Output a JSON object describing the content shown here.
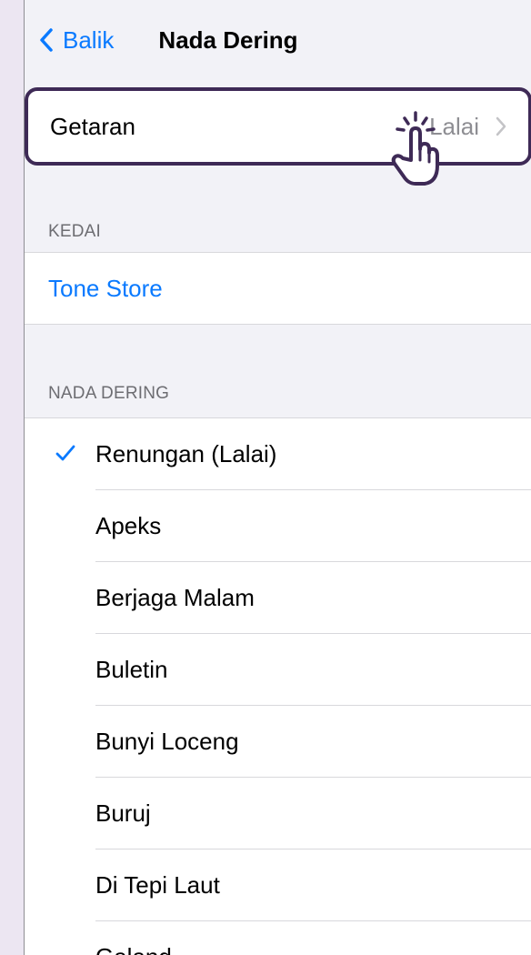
{
  "nav": {
    "back_label": "Balik",
    "title": "Nada Dering"
  },
  "vibration": {
    "label": "Getaran",
    "value": "Lalai"
  },
  "store_section": {
    "header": "KEDAI",
    "item": "Tone Store"
  },
  "ringtone_section": {
    "header": "NADA DERING",
    "items": [
      {
        "label": "Renungan (Lalai)",
        "selected": true
      },
      {
        "label": "Apeks"
      },
      {
        "label": "Berjaga Malam"
      },
      {
        "label": "Buletin"
      },
      {
        "label": "Bunyi Loceng"
      },
      {
        "label": "Buruj"
      },
      {
        "label": "Di Tepi Laut"
      },
      {
        "label": "Galand"
      }
    ]
  },
  "colors": {
    "accent": "#0a7aff",
    "highlight_border": "#3e2a56",
    "page_bg": "#f2f2f7",
    "outer_bg": "#ece6f2"
  },
  "icons": {
    "back": "chevron-left-icon",
    "disclosure": "chevron-right-icon",
    "tap": "tap-hand-icon",
    "check": "checkmark-icon"
  }
}
